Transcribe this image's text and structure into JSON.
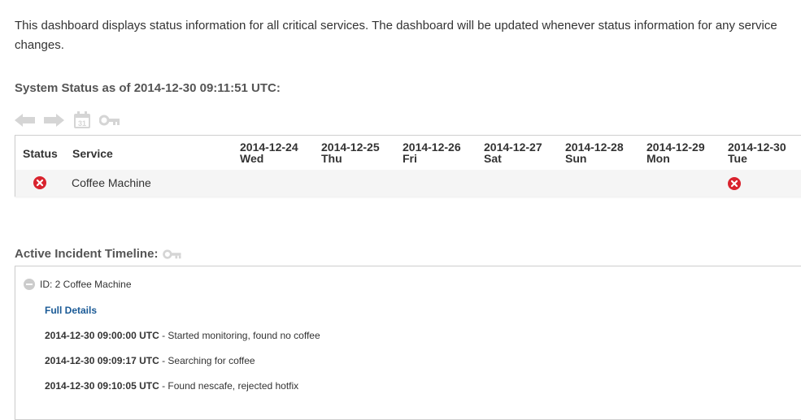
{
  "intro_text": "This dashboard displays status information for all critical services. The dashboard will be updated whenever status information for any service changes.",
  "status_section": {
    "title": "System Status as of 2014-12-30 09:11:51 UTC:",
    "toolbar": [
      {
        "name": "back-arrow-icon"
      },
      {
        "name": "forward-arrow-icon"
      },
      {
        "name": "calendar-icon",
        "label": "31"
      },
      {
        "name": "key-icon"
      }
    ],
    "columns": {
      "status": "Status",
      "service": "Service"
    },
    "dates": [
      {
        "date": "2014-12-24",
        "day": "Wed"
      },
      {
        "date": "2014-12-25",
        "day": "Thu"
      },
      {
        "date": "2014-12-26",
        "day": "Fri"
      },
      {
        "date": "2014-12-27",
        "day": "Sat"
      },
      {
        "date": "2014-12-28",
        "day": "Sun"
      },
      {
        "date": "2014-12-29",
        "day": "Mon"
      },
      {
        "date": "2014-12-30",
        "day": "Tue"
      }
    ],
    "rows": [
      {
        "service": "Coffee Machine",
        "status": "error",
        "daily": [
          "",
          "",
          "",
          "",
          "",
          "",
          "error"
        ]
      }
    ],
    "colors": {
      "error": "#d9232e",
      "icon_gray": "#d5d5d5",
      "link": "#1a5a96"
    }
  },
  "timeline_section": {
    "title": "Active Incident Timeline:",
    "incident": {
      "header": "ID: 2 Coffee Machine",
      "full_details_label": "Full Details",
      "updates": [
        {
          "time": "2014-12-30 09:00:00 UTC",
          "text": " - Started monitoring, found no coffee"
        },
        {
          "time": "2014-12-30 09:09:17 UTC",
          "text": " - Searching for coffee"
        },
        {
          "time": "2014-12-30 09:10:05 UTC",
          "text": " - Found nescafe, rejected hotfix"
        }
      ]
    }
  }
}
